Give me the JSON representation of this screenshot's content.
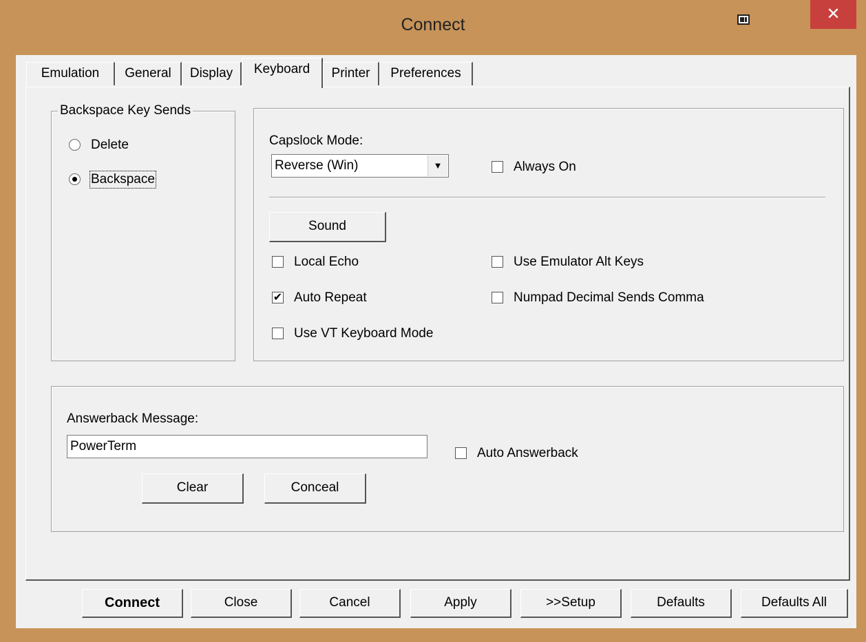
{
  "window": {
    "title": "Connect",
    "close_glyph": "✕"
  },
  "tabs": [
    {
      "label": "Emulation",
      "active": false
    },
    {
      "label": "General",
      "active": false
    },
    {
      "label": "Display",
      "active": false
    },
    {
      "label": "Keyboard",
      "active": true
    },
    {
      "label": "Printer",
      "active": false
    },
    {
      "label": "Preferences",
      "active": false
    }
  ],
  "backspace_group": {
    "legend": "Backspace Key Sends",
    "options": [
      {
        "label": "Delete",
        "selected": false
      },
      {
        "label": "Backspace",
        "selected": true
      }
    ]
  },
  "keyboard": {
    "capslock_label": "Capslock Mode:",
    "capslock_value": "Reverse (Win)",
    "always_on_label": "Always On",
    "always_on_checked": false,
    "sound_button": "Sound",
    "local_echo": {
      "label": "Local Echo",
      "checked": false
    },
    "auto_repeat": {
      "label": "Auto Repeat",
      "checked": true
    },
    "use_vt": {
      "label": "Use VT Keyboard Mode",
      "checked": false
    },
    "emulator_alt": {
      "label": "Use Emulator Alt Keys",
      "checked": false
    },
    "numpad_comma": {
      "label": "Numpad Decimal Sends Comma",
      "checked": false
    }
  },
  "answerback": {
    "label": "Answerback Message:",
    "value": "PowerTerm",
    "auto_label": "Auto Answerback",
    "auto_checked": false,
    "clear_button": "Clear",
    "conceal_button": "Conceal"
  },
  "footer": {
    "connect": "Connect",
    "close": "Close",
    "cancel": "Cancel",
    "apply": "Apply",
    "setup": ">>Setup",
    "defaults": "Defaults",
    "defaults_all": "Defaults All"
  },
  "colors": {
    "frame": "#c79358",
    "close_button": "#c7403d",
    "dialog_bg": "#f0f0f0"
  }
}
